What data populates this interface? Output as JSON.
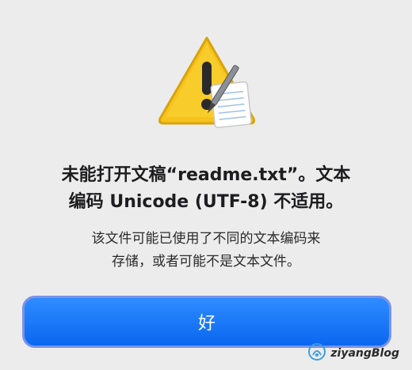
{
  "dialog": {
    "title_line1": "未能打开文稿“readme.txt”。文本",
    "title_line2": "编码 Unicode (UTF-8) 不适用。",
    "message_line1": "该文件可能已使用了不同的文本编码来",
    "message_line2": "存储，或者可能不是文本文件。",
    "ok_label": "好",
    "icon": "warning-triangle-with-textedit-icon"
  },
  "watermark": {
    "text": "ziyangBlog",
    "icon": "signal-logo-icon"
  },
  "colors": {
    "background": "#ececec",
    "button_blue": "#1a7bff",
    "button_focus_ring": "#7a93e8",
    "warning_yellow": "#f6c21c"
  }
}
